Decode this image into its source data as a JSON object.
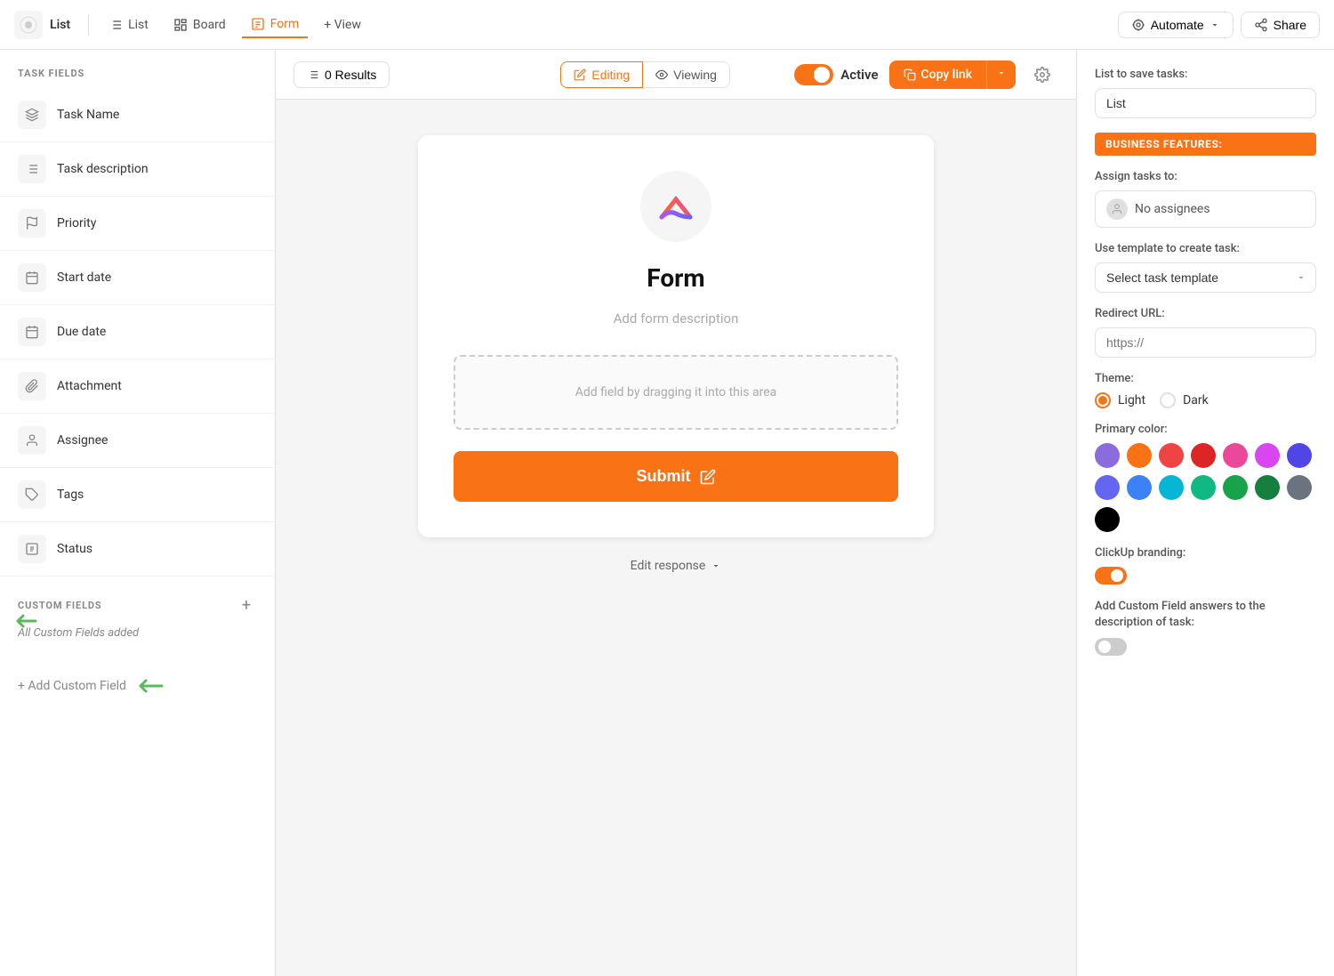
{
  "nav": {
    "logo_label": "List",
    "items": [
      {
        "label": "List",
        "icon": "list-icon",
        "active": false
      },
      {
        "label": "Board",
        "icon": "board-icon",
        "active": false
      },
      {
        "label": "Form",
        "icon": "form-icon",
        "active": true
      },
      {
        "label": "+ View",
        "icon": "view-icon",
        "active": false
      }
    ],
    "automate_label": "Automate",
    "share_label": "Share"
  },
  "sidebar": {
    "task_fields_label": "TASK FIELDS",
    "fields": [
      {
        "label": "Task Name",
        "icon": "task-name-icon"
      },
      {
        "label": "Task description",
        "icon": "description-icon"
      },
      {
        "label": "Priority",
        "icon": "priority-icon"
      },
      {
        "label": "Start date",
        "icon": "start-date-icon"
      },
      {
        "label": "Due date",
        "icon": "due-date-icon"
      },
      {
        "label": "Attachment",
        "icon": "attachment-icon"
      },
      {
        "label": "Assignee",
        "icon": "assignee-icon"
      },
      {
        "label": "Tags",
        "icon": "tags-icon"
      },
      {
        "label": "Status",
        "icon": "status-icon"
      }
    ],
    "custom_fields_label": "CUSTOM FIELDS",
    "custom_fields_text": "All Custom Fields added",
    "add_custom_field_label": "+ Add Custom Field"
  },
  "toolbar": {
    "results_label": "0 Results",
    "editing_label": "Editing",
    "viewing_label": "Viewing",
    "active_label": "Active",
    "copy_link_label": "Copy link"
  },
  "form": {
    "title": "Form",
    "description_placeholder": "Add form description",
    "drop_area_text": "Add field by dragging it into this area",
    "submit_label": "Submit",
    "edit_response_label": "Edit response"
  },
  "right_panel": {
    "list_label": "List to save tasks:",
    "list_value": "List",
    "business_features_label": "BUSINESS FEATURES:",
    "assign_tasks_label": "Assign tasks to:",
    "no_assignees_label": "No assignees",
    "template_label": "Use template to create task:",
    "template_placeholder": "Select task template",
    "redirect_label": "Redirect URL:",
    "redirect_placeholder": "https://",
    "theme_label": "Theme:",
    "theme_light": "Light",
    "theme_dark": "Dark",
    "primary_color_label": "Primary color:",
    "colors": [
      "#8b6cdc",
      "#f97316",
      "#ef4444",
      "#dc2626",
      "#ec4899",
      "#d946ef",
      "#4f46e5",
      "#6366f1",
      "#3b82f6",
      "#06b6d4",
      "#10b981",
      "#16a34a",
      "#15803d",
      "#6b7280",
      "#000000"
    ],
    "branding_label": "ClickUp branding:",
    "custom_field_label": "Add Custom Field answers to the description of task:"
  }
}
